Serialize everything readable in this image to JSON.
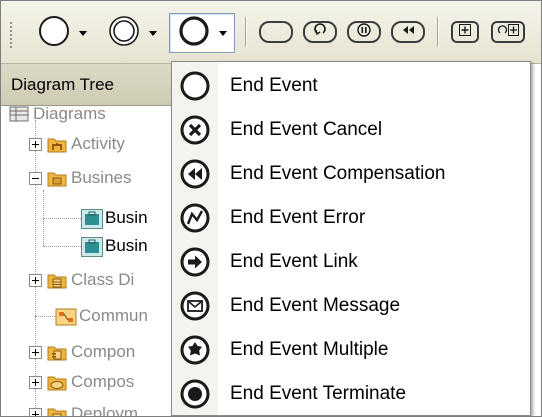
{
  "toolbar": {
    "groups": [
      {
        "name": "end-event-plain",
        "icon": "circle-thin-icon"
      },
      {
        "name": "intermediate-event",
        "icon": "double-circle-icon"
      },
      {
        "name": "end-event",
        "icon": "circle-thick-icon",
        "active": true
      }
    ],
    "buttons": [
      {
        "name": "task-button",
        "icon": "rounded-rect-icon"
      },
      {
        "name": "loop-task-button",
        "icon": "loop-rounded-rect-icon"
      },
      {
        "name": "parallel-task-button",
        "icon": "pause-rounded-rect-icon"
      },
      {
        "name": "compensation-task-button",
        "icon": "rewind-rounded-rect-icon"
      },
      {
        "name": "subprocess-button",
        "icon": "plus-square-icon"
      },
      {
        "name": "adhoc-subprocess-button",
        "icon": "loop-plus-square-icon"
      }
    ]
  },
  "tree": {
    "header": "Diagram Tree",
    "items": [
      {
        "label": "Diagrams",
        "level": 0,
        "icon": "diagrams-icon"
      },
      {
        "label": "Activity",
        "level": 1,
        "icon": "activity-folder-icon",
        "expander": "plus"
      },
      {
        "label": "Busines",
        "level": 1,
        "icon": "business-folder-icon",
        "expander": "minus"
      },
      {
        "label": "Busin",
        "level": 2,
        "icon": "business-diagram-icon",
        "dark": true
      },
      {
        "label": "Busin",
        "level": 2,
        "icon": "business-diagram-icon",
        "dark": true
      },
      {
        "label": "Class Di",
        "level": 1,
        "icon": "class-folder-icon",
        "expander": "plus"
      },
      {
        "label": "Commun",
        "level": 1,
        "icon": "communication-icon"
      },
      {
        "label": "Compon",
        "level": 1,
        "icon": "component-folder-icon",
        "expander": "plus"
      },
      {
        "label": "Compos",
        "level": 1,
        "icon": "composite-folder-icon",
        "expander": "plus"
      },
      {
        "label": "Deploym",
        "level": 1,
        "icon": "deployment-folder-icon",
        "expander": "plus"
      }
    ]
  },
  "menu": {
    "items": [
      {
        "label": "End Event",
        "icon": "end-event-icon"
      },
      {
        "label": "End Event Cancel",
        "icon": "end-event-cancel-icon"
      },
      {
        "label": "End Event Compensation",
        "icon": "end-event-compensation-icon"
      },
      {
        "label": "End Event Error",
        "icon": "end-event-error-icon"
      },
      {
        "label": "End Event Link",
        "icon": "end-event-link-icon"
      },
      {
        "label": "End Event Message",
        "icon": "end-event-message-icon"
      },
      {
        "label": "End Event Multiple",
        "icon": "end-event-multiple-icon"
      },
      {
        "label": "End Event Terminate",
        "icon": "end-event-terminate-icon"
      }
    ]
  },
  "colors": {
    "toolbar_bg": "#ece9d8",
    "folder": "#f0b541",
    "diagram_teal": "#2e8f93",
    "icon_stroke": "#1a1a1a"
  }
}
